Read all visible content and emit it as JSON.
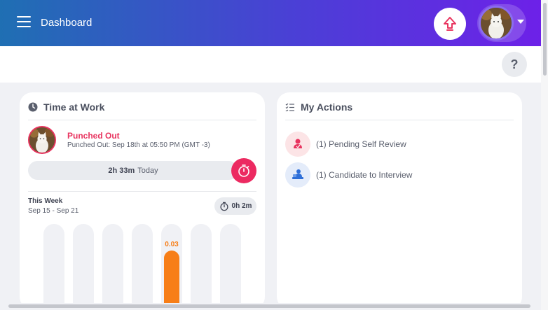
{
  "header": {
    "title": "Dashboard",
    "menu_icon": "hamburger-menu-icon",
    "upgrade_icon": "upgrade-arrow-icon",
    "profile_icon": "chevron-down-icon",
    "gradient": [
      "#1f6fb3",
      "#6d21e8"
    ]
  },
  "subbar": {
    "help_label": "?"
  },
  "time_at_work": {
    "title": "Time at Work",
    "icon": "clock-icon",
    "status": "Punched Out",
    "status_color": "#e8345f",
    "detail": "Punched Out: Sep 18th at 05:50 PM (GMT -3)",
    "today_hours": "2h 33m",
    "today_label": "Today",
    "timer_icon": "stopwatch-icon",
    "week_label": "This Week",
    "week_range": "Sep 15 - Sep 21",
    "week_total": "0h 2m",
    "chart_data": {
      "type": "bar",
      "categories": [
        "",
        "",
        "",
        "",
        "",
        "",
        ""
      ],
      "values": [
        0,
        0,
        0,
        0,
        0.03,
        0,
        0
      ],
      "data_labels": [
        "",
        "",
        "",
        "",
        "0.03",
        "",
        ""
      ],
      "ylim": [
        0,
        0.05
      ],
      "bar_color": "#f77e17"
    }
  },
  "my_actions": {
    "title": "My Actions",
    "icon": "list-icon",
    "items": [
      {
        "label": "(1) Pending Self Review",
        "icon": "self-review-icon",
        "bg": "#fce4e6",
        "color": "#e8345f"
      },
      {
        "label": "(1) Candidate to Interview",
        "icon": "candidate-interview-icon",
        "bg": "#e4ecfa",
        "color": "#2e6fd8"
      }
    ]
  }
}
